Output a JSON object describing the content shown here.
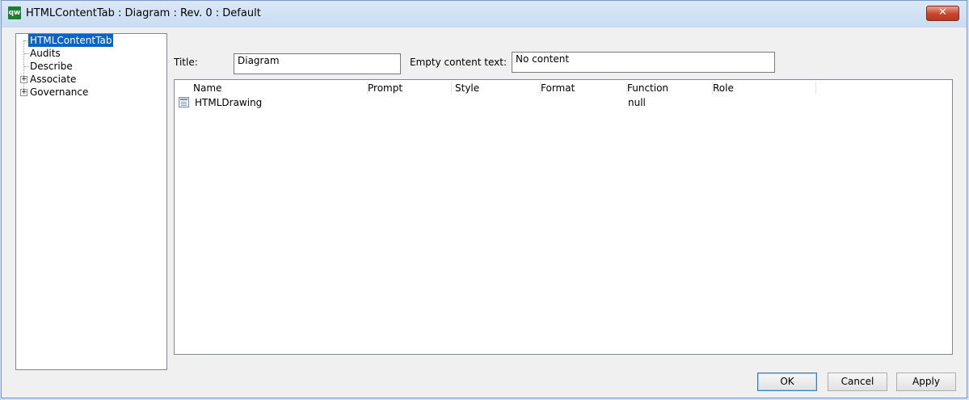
{
  "window": {
    "title": "HTMLContentTab : Diagram : Rev. 0  : Default",
    "app_icon_text": "qw",
    "close_icon": "close-icon"
  },
  "tree": {
    "items": [
      {
        "label": "HTMLContentTab",
        "selected": true,
        "expandable": false
      },
      {
        "label": "Audits",
        "selected": false,
        "expandable": false
      },
      {
        "label": "Describe",
        "selected": false,
        "expandable": false
      },
      {
        "label": "Associate",
        "selected": false,
        "expandable": true
      },
      {
        "label": "Governance",
        "selected": false,
        "expandable": true
      }
    ]
  },
  "form": {
    "title_label": "Title:",
    "title_value": "Diagram",
    "empty_label": "Empty content text:",
    "empty_value": "No content"
  },
  "grid": {
    "columns": [
      "Name",
      "Prompt",
      "Style",
      "Format",
      "Function",
      "Role"
    ],
    "rows": [
      {
        "icon": "table-icon",
        "name": "HTMLDrawing",
        "prompt": "",
        "style": "",
        "format": "",
        "function": "null",
        "role": ""
      }
    ]
  },
  "buttons": {
    "ok": "OK",
    "cancel": "Cancel",
    "apply": "Apply"
  },
  "colors": {
    "selection": "#0a64c8",
    "close_button": "#c6452d"
  }
}
